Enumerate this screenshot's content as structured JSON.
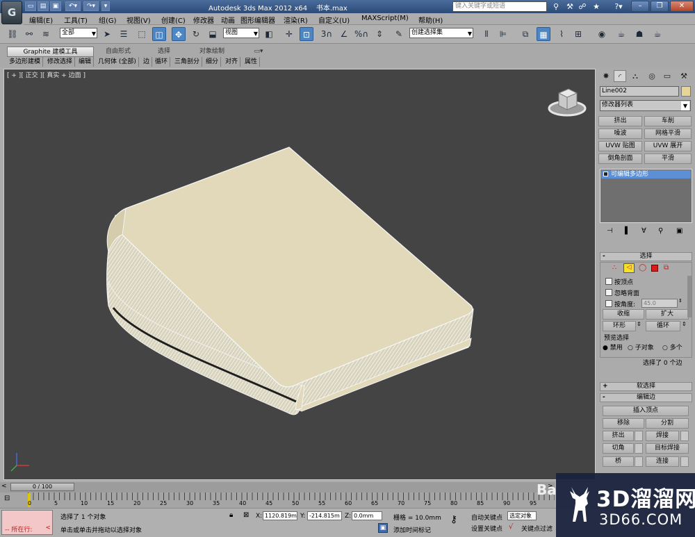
{
  "titlebar": {
    "app_title": "Autodesk 3ds Max  2012 x64",
    "file_name": "书本.max",
    "search_placeholder": "键入关键字或短语",
    "logo": "G"
  },
  "menu": [
    "编辑(E)",
    "工具(T)",
    "组(G)",
    "视图(V)",
    "创建(C)",
    "修改器",
    "动画",
    "图形编辑器",
    "渲染(R)",
    "自定义(U)",
    "MAXScript(M)",
    "帮助(H)"
  ],
  "toolbar": {
    "selection_filter": "全部",
    "reference_coord": "视图",
    "named_selection": "创建选择集"
  },
  "ribbon": {
    "tabs": [
      "Graphite 建模工具",
      "自由形式",
      "选择",
      "对象绘制"
    ],
    "subtabs": [
      "多边形建模",
      "修改选择",
      "编辑",
      "几何体 (全部)",
      "边",
      "循环",
      "三角剖分",
      "细分",
      "对齐",
      "属性"
    ]
  },
  "viewport": {
    "label": "[ + ][ 正交 ][ 真实 + 边面 ]",
    "book_cover_color": "#e1d9b9",
    "background_color": "#444444"
  },
  "command_panel": {
    "object_name": "Line002",
    "object_color": "#e6d596",
    "modifier_list": "修改器列表",
    "modifier_buttons": [
      "挤出",
      "车削",
      "噪波",
      "网格平滑",
      "UVW 贴图",
      "UVW 展开",
      "倒角剖面",
      "平滑"
    ],
    "stack_item": "可编辑多边形",
    "selection": {
      "title": "选择",
      "by_vertex": "按顶点",
      "ignore_backfacing": "忽略背面",
      "by_angle": "按角度:",
      "angle_value": "45.0",
      "shrink": "收缩",
      "grow": "扩大",
      "ring": "环形",
      "loop": "循环",
      "preview_title": "预览选择",
      "preview_options": [
        "禁用",
        "子对象",
        "多个"
      ],
      "status": "选择了 0 个边"
    },
    "soft_selection": "软选择",
    "edit_edges": {
      "title": "编辑边",
      "insert_vertex": "插入顶点",
      "remove": "移除",
      "split": "分割",
      "extrude": "挤出",
      "weld": "焊接",
      "chamfer": "切角",
      "target_weld": "目标焊接",
      "bridge": "桥",
      "connect": "连接"
    }
  },
  "timeline": {
    "frame_display": "0 / 100",
    "ticks": [
      "0",
      "5",
      "10",
      "15",
      "20",
      "25",
      "30",
      "35",
      "40",
      "45",
      "50",
      "55",
      "60",
      "65",
      "70",
      "75",
      "80",
      "85",
      "90",
      "95"
    ]
  },
  "status": {
    "listener_label": "所在行:",
    "selection_info": "选择了 1 个对象",
    "prompt": "单击或单击并拖动以选择对象",
    "x_value": "1120.819m",
    "y_value": "-214.815m",
    "z_value": "0.0mm",
    "grid": "栅格 = 10.0mm",
    "add_time_tag": "添加时间标记",
    "auto_key": "自动关键点",
    "set_key": "设置关键点",
    "selected_object": "选定对象",
    "key_filters": "关键点过滤"
  },
  "watermark": {
    "brand": "3D溜溜网",
    "url": "3D66.COM",
    "corner_text": "Ba"
  }
}
